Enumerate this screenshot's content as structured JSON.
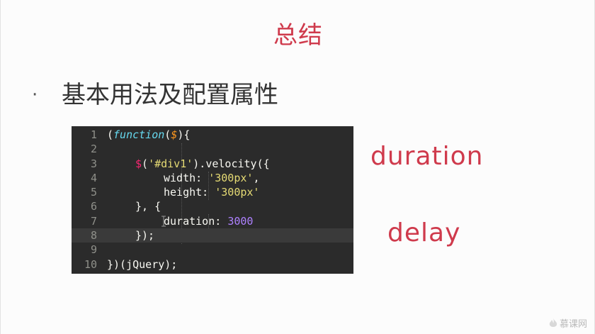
{
  "slide": {
    "title": "总结",
    "bullet_marker": "·",
    "bullet_text": "基本用法及配置属性",
    "labels": {
      "duration": "duration",
      "delay": "delay"
    },
    "watermark": "慕课网"
  },
  "code": {
    "highlighted_line": 8,
    "lines": [
      {
        "num": "1"
      },
      {
        "num": "2"
      },
      {
        "num": "3"
      },
      {
        "num": "4"
      },
      {
        "num": "5"
      },
      {
        "num": "6"
      },
      {
        "num": "7"
      },
      {
        "num": "8"
      },
      {
        "num": "9"
      },
      {
        "num": "10"
      }
    ],
    "tokens": {
      "l1_open": "(",
      "l1_kw": "function",
      "l1_p1": "(",
      "l1_arg": "$",
      "l1_p2": "){",
      "l3_fn": "$",
      "l3_p1": "(",
      "l3_str": "'#div1'",
      "l3_rest": ").velocity({",
      "l4_key": "width: ",
      "l4_str": "'300px'",
      "l4_rest": ",",
      "l5_key": "height: ",
      "l5_str": "'300px'",
      "l6_text": "}, {",
      "l7_key": "duration: ",
      "l7_num": "3000",
      "l8_text": "});",
      "l10_text": "})(jQuery);"
    }
  },
  "colors": {
    "accent": "#cf3a4c",
    "code_bg": "#2b2b2b",
    "text": "#333333"
  }
}
